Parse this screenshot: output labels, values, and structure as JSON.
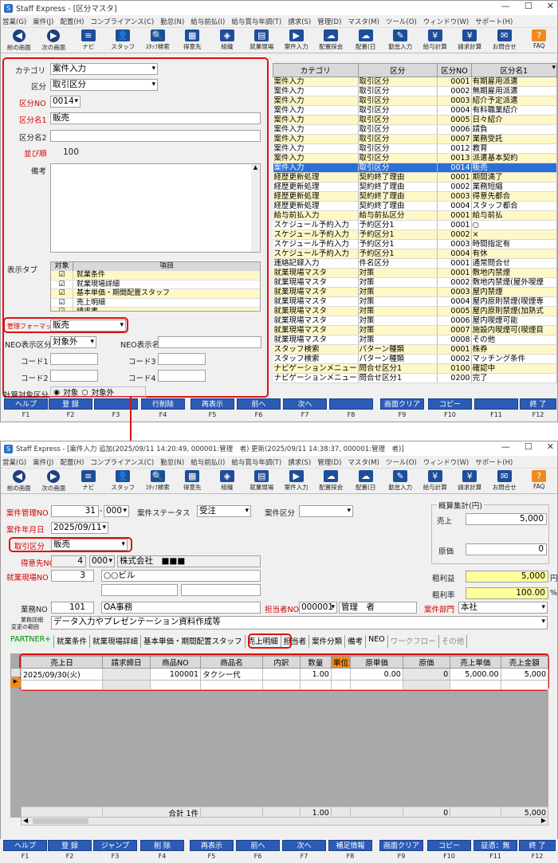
{
  "w1": {
    "title": "Staff Express - [区分マスタ]",
    "menu": [
      "営業(G)",
      "案件(J)",
      "配置(H)",
      "コンプライアンス(C)",
      "勤怠(N)",
      "給与前払(I)",
      "給与賞与年調(T)",
      "請求(S)",
      "管理(D)",
      "マスタ(M)",
      "ツール(O)",
      "ウィンドウ(W)",
      "サポート(H)"
    ],
    "toolbar": [
      "前の画面",
      "次の画面",
      "ナビ",
      "スタッフ",
      "ｽﾀｯﾌ検索",
      "得意先",
      "組織",
      "就業現場",
      "案件入力",
      "配置採会",
      "配置(日",
      "勤怠入力",
      "給与計算",
      "請求計算",
      "お問合せ",
      "FAQ"
    ],
    "form": {
      "category_label": "カテゴリ",
      "category_value": "案件入力",
      "kubun_label": "区分",
      "kubun_value": "取引区分",
      "kubun_no_label": "区分NO",
      "kubun_no_value": "0014",
      "kubun_name1_label": "区分名1",
      "kubun_name1_value": "販売",
      "kubun_name2_label": "区分名2",
      "kubun_name2_value": "",
      "order_label": "並び順",
      "order_value": "100",
      "remarks_label": "備考",
      "remarks_value": "",
      "display_tab_label": "表示タブ",
      "tab_head_target": "対象",
      "tab_head_item": "項目",
      "tab_items": [
        "就業条件",
        "就業現場詳細",
        "基本単価・期間配置スタッフ",
        "売上明細",
        "請求書"
      ],
      "mgmt_format_label": "管理フォーマット",
      "mgmt_format_value": "販売",
      "neo_kubun_label": "NEO表示区分",
      "neo_kubun_value": "対象外",
      "neo_name_label": "NEO表示名",
      "code1_label": "コード1",
      "code2_label": "コード2",
      "code3_label": "コード3",
      "code4_label": "コード4",
      "calc_label": "計算対象区分",
      "calc_opt1": "対象",
      "calc_opt2": "対象外"
    },
    "grid_head": [
      "カテゴリ",
      "区分",
      "区分NO",
      "区分名1"
    ],
    "grid_rows": [
      [
        "案件入力",
        "取引区分",
        "0001",
        "有期雇用派遣"
      ],
      [
        "案件入力",
        "取引区分",
        "0002",
        "無期雇用派遣"
      ],
      [
        "案件入力",
        "取引区分",
        "0003",
        "紹介予定派遣"
      ],
      [
        "案件入力",
        "取引区分",
        "0004",
        "有料職業紹介"
      ],
      [
        "案件入力",
        "取引区分",
        "0005",
        "日々紹介"
      ],
      [
        "案件入力",
        "取引区分",
        "0006",
        "請負"
      ],
      [
        "案件入力",
        "取引区分",
        "0007",
        "業務受託"
      ],
      [
        "案件入力",
        "取引区分",
        "0012",
        "教育"
      ],
      [
        "案件入力",
        "取引区分",
        "0013",
        "派遣基本契約"
      ],
      [
        "案件入力",
        "取引区分",
        "0014",
        "販売"
      ],
      [
        "経歴更新処理",
        "契約終了理由",
        "0001",
        "期間満了"
      ],
      [
        "経歴更新処理",
        "契約終了理由",
        "0002",
        "業務短縮"
      ],
      [
        "経歴更新処理",
        "契約終了理由",
        "0003",
        "得意先都合"
      ],
      [
        "経歴更新処理",
        "契約終了理由",
        "0004",
        "スタッフ都合"
      ],
      [
        "給与前払入力",
        "給与前払区分",
        "0001",
        "給与前払"
      ],
      [
        "スケジュール予約入力",
        "予約区分1",
        "0001",
        "○"
      ],
      [
        "スケジュール予約入力",
        "予約区分1",
        "0002",
        "×"
      ],
      [
        "スケジュール予約入力",
        "予約区分1",
        "0003",
        "時間指定有"
      ],
      [
        "スケジュール予約入力",
        "予約区分1",
        "0004",
        "有休"
      ],
      [
        "連絡記録入力",
        "件名区分",
        "0001",
        "通常問合せ"
      ],
      [
        "就業現場マスタ",
        "対策",
        "0001",
        "敷地内禁煙"
      ],
      [
        "就業現場マスタ",
        "対策",
        "0002",
        "敷地内禁煙(屋外喫煙"
      ],
      [
        "就業現場マスタ",
        "対策",
        "0003",
        "屋内禁煙"
      ],
      [
        "就業現場マスタ",
        "対策",
        "0004",
        "屋内原則禁煙(喫煙専"
      ],
      [
        "就業現場マスタ",
        "対策",
        "0005",
        "屋内原則禁煙(加熱式"
      ],
      [
        "就業現場マスタ",
        "対策",
        "0006",
        "屋内喫煙可能"
      ],
      [
        "就業現場マスタ",
        "対策",
        "0007",
        "施設内喫煙可(喫煙目"
      ],
      [
        "就業現場マスタ",
        "対策",
        "0008",
        "その他"
      ],
      [
        "スタッフ検索",
        "パターン種類",
        "0001",
        "株券"
      ],
      [
        "スタッフ検索",
        "パターン種類",
        "0002",
        "マッチング条件"
      ],
      [
        "ナビゲーションメニュー",
        "問合せ区分1",
        "0100",
        "確認中"
      ],
      [
        "ナビゲーションメニュー",
        "問合せ区分1",
        "0200",
        "完了"
      ]
    ],
    "fkeys": [
      "ヘルプ",
      "登 録",
      "",
      "行削除",
      "再表示",
      "前へ",
      "次へ",
      "",
      "画面クリア",
      "コピー",
      "",
      "終 了"
    ]
  },
  "w2": {
    "title": "Staff Express - [案件入力 追加(2025/09/11 14:20:49, 000001:管理　者) 更新(2025/09/11 14:38:37, 000001:管理　者)]",
    "menu": [
      "営業(G)",
      "案件(J)",
      "配置(H)",
      "コンプライアンス(C)",
      "勤怠(N)",
      "給与前払(I)",
      "給与賞与年調(T)",
      "請求(S)",
      "管理(D)",
      "マスタ(M)",
      "ツール(O)",
      "ウィンドウ(W)",
      "サポート(H)"
    ],
    "toolbar": [
      "前の画面",
      "次の画面",
      "ナビ",
      "スタッフ",
      "ｽﾀｯﾌ検索",
      "得意先",
      "組織",
      "就業現場",
      "案件入力",
      "配置採会",
      "配置(日",
      "勤怠入力",
      "給与計算",
      "請求計算",
      "お問合せ",
      "FAQ"
    ],
    "form": {
      "mgmt_no_label": "案件管理NO",
      "mgmt_no_value": "31",
      "mgmt_no_sub": "000",
      "status_label": "案件ステータス",
      "status_value": "受注",
      "kubun_label": "案件区分",
      "kubun_value": "",
      "date_label": "案件年月日",
      "date_value": "2025/09/11",
      "torihiki_label": "取引区分",
      "torihiki_value": "販売",
      "tokui_label": "得意先NO",
      "tokui_value": "4",
      "tokui_sub": "000",
      "tokui_name": "株式会社　■■■",
      "genba_label": "就業現場NO",
      "genba_value": "3",
      "genba_name": "○○ビル",
      "gyomu_label": "業務NO",
      "gyomu_value": "101",
      "gyomu_name": "OA事務",
      "tanto_label": "担当者NO",
      "tanto_value": "000001",
      "tanto_name": "管理　者",
      "bumon_label": "案件部門",
      "bumon_value": "本社",
      "detail_label1": "業務詳細",
      "detail_label2": "変更の範囲",
      "detail_value": "データ入力やプレゼンテーション資料作成等",
      "summary_title": "概算集計(円)",
      "uriage_label": "売上",
      "uriage_value": "5,000",
      "genka_label": "原価",
      "genka_value": "0",
      "arari_label": "粗利益",
      "arari_value": "5,000",
      "arari_unit": "円",
      "arariritsu_label": "粗利率",
      "arariritsu_value": "100.00",
      "arariritsu_unit": "%"
    },
    "tabs": [
      "PARTNER+",
      "就業条件",
      "就業現場詳細",
      "基本単価・期間配置スタッフ",
      "売上明細",
      "担当者",
      "案件分類",
      "備考",
      "NEO",
      "ワークフロー",
      "その他"
    ],
    "grid_head": [
      "売上日",
      "請求締日",
      "商品NO",
      "商品名",
      "内訳",
      "数量",
      "単位",
      "原単価",
      "原価",
      "売上単価",
      "売上金額"
    ],
    "grid_row": [
      "2025/09/30(火)",
      "",
      "100001",
      "タクシー代",
      "",
      "1.00",
      "",
      "0.00",
      "0",
      "5,000.00",
      "5,000"
    ],
    "footer": {
      "total_label": "合計 1件",
      "qty": "1.00",
      "cost": "0",
      "amount": "5,000"
    },
    "fkeys": [
      "ヘルプ",
      "登 録",
      "ジャンプ",
      "削 除",
      "再表示",
      "前へ",
      "次へ",
      "補足情報",
      "画面クリア",
      "コピー",
      "証憑：無",
      "終 了"
    ]
  },
  "fkey_names": [
    "F1",
    "F2",
    "F3",
    "F4",
    "F5",
    "F6",
    "F7",
    "F8",
    "F9",
    "F10",
    "F11",
    "F12"
  ],
  "colors": {
    "accent": "#2c5bb6",
    "highlight": "#e01010",
    "row_yellow": "#fff8c6",
    "selected": "#2b6fd6"
  }
}
